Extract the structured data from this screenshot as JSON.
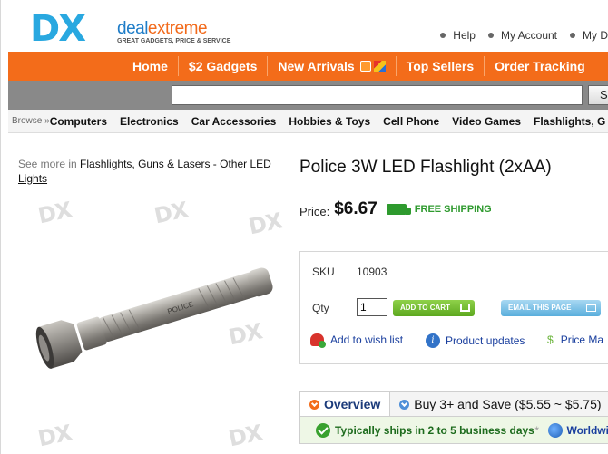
{
  "header": {
    "logo_mark": "DX",
    "logo_name_a": "deal",
    "logo_name_b": "extreme",
    "logo_tagline": "GREAT GADGETS, PRICE & SERVICE",
    "toplinks": [
      "Help",
      "My Account",
      "My D"
    ]
  },
  "nav": {
    "items": [
      "Home",
      "$2 Gadgets",
      "New Arrivals",
      "Top Sellers",
      "Order Tracking"
    ]
  },
  "search": {
    "value": "",
    "button_label": "Se"
  },
  "categories": {
    "browse_label": "Browse »",
    "items": [
      "Computers",
      "Electronics",
      "Car Accessories",
      "Hobbies & Toys",
      "Cell Phone",
      "Video Games",
      "Flashlights, G"
    ]
  },
  "breadcrumb": {
    "prefix": "See more in",
    "link": "Flashlights, Guns & Lasers - Other LED Lights"
  },
  "product": {
    "title": "Police 3W LED Flashlight (2xAA)",
    "price_label": "Price:",
    "price": "$6.67",
    "free_shipping": "FREE SHIPPING",
    "sku_label": "SKU",
    "sku": "10903",
    "qty_label": "Qty",
    "qty": "1",
    "add_to_cart": "ADD TO CART",
    "email_page": "EMAIL THIS PAGE",
    "wishlist": "Add to wish list",
    "updates": "Product updates",
    "price_match": "Price Ma",
    "engraving": "POLICE",
    "watermark": "DX"
  },
  "tabs": {
    "overview": "Overview",
    "buy_more": "Buy 3+ and Save ($5.55 ~ $5.75)"
  },
  "shipping": {
    "text": "Typically ships in 2 to 5 business days",
    "asterisk": "*",
    "worldwide": "Worldwic"
  },
  "colors": {
    "nav_orange": "#f36c1a",
    "search_gray": "#898989",
    "logo_blue": "#29a8e0",
    "shipping_green": "#2e9a2e"
  }
}
